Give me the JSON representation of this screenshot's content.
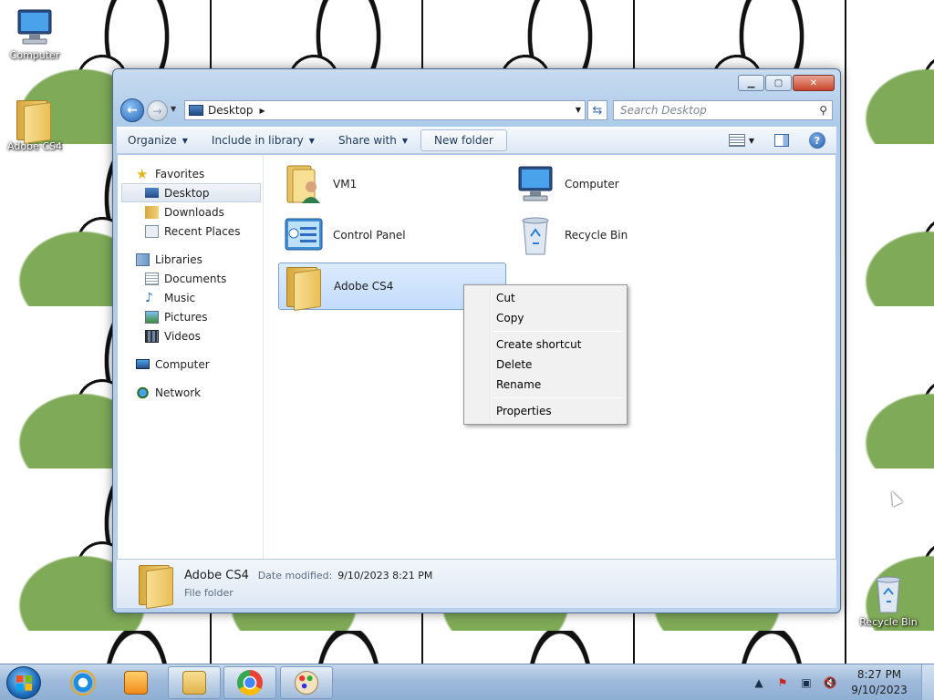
{
  "desktop": {
    "icons": [
      {
        "label": "Computer"
      },
      {
        "label": "Adobe CS4"
      },
      {
        "label": "Recycle Bin"
      }
    ]
  },
  "window": {
    "address": {
      "location": "Desktop"
    },
    "search": {
      "placeholder": "Search Desktop"
    },
    "toolbar": {
      "organize": "Organize",
      "include_in_library": "Include in library",
      "share_with": "Share with",
      "new_folder": "New folder"
    },
    "nav": {
      "favorites": "Favorites",
      "desktop": "Desktop",
      "downloads": "Downloads",
      "recent_places": "Recent Places",
      "libraries": "Libraries",
      "documents": "Documents",
      "music": "Music",
      "pictures": "Pictures",
      "videos": "Videos",
      "computer": "Computer",
      "network": "Network"
    },
    "items": [
      {
        "label": "VM1"
      },
      {
        "label": "Computer"
      },
      {
        "label": "Control Panel"
      },
      {
        "label": "Recycle Bin"
      },
      {
        "label": "Adobe CS4"
      }
    ],
    "details": {
      "name": "Adobe CS4",
      "modified_label": "Date modified:",
      "modified_value": "9/10/2023 8:21 PM",
      "type": "File folder"
    }
  },
  "context_menu": {
    "cut": "Cut",
    "copy": "Copy",
    "create_shortcut": "Create shortcut",
    "delete": "Delete",
    "rename": "Rename",
    "properties": "Properties"
  },
  "taskbar": {
    "clock_time": "8:27 PM",
    "clock_date": "9/10/2023"
  },
  "colors": {
    "selection": "#c2dcfc",
    "window_frame": "#aecbe9",
    "taskbar": "#9fbbdb"
  }
}
